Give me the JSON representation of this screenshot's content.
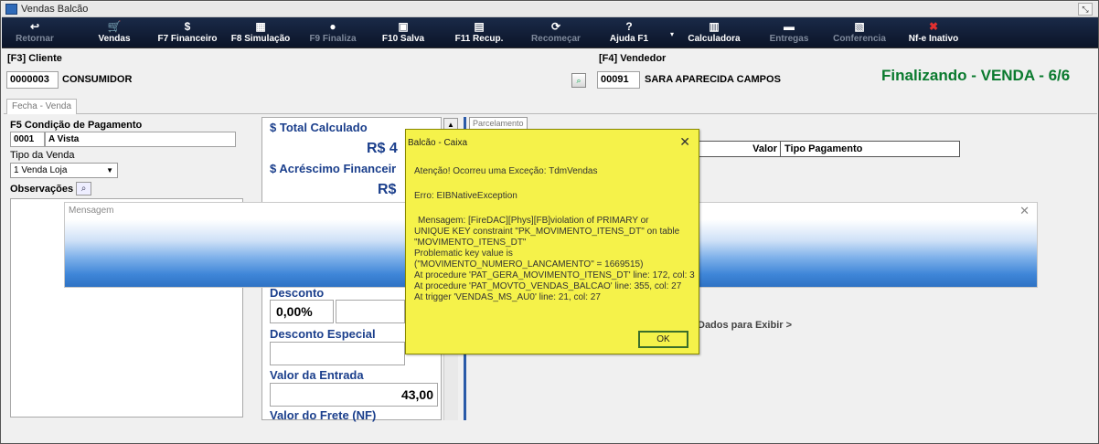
{
  "window": {
    "title": "Vendas Balcão",
    "restore_glyph": "⤡"
  },
  "toolbar": {
    "items": [
      {
        "label": "Retornar",
        "icon": "return-arrow-icon",
        "glyph": "↩",
        "enabled": false
      },
      {
        "label": "Vendas",
        "icon": "sales-icon",
        "glyph": "🛒",
        "enabled": true
      },
      {
        "label": "F7 Financeiro",
        "icon": "money-icon",
        "glyph": "$",
        "enabled": true
      },
      {
        "label": "F8 Simulação",
        "icon": "calculator-grid-icon",
        "glyph": "▦",
        "enabled": true
      },
      {
        "label": "F9 Finaliza",
        "icon": "finish-icon",
        "glyph": "●",
        "enabled": false
      },
      {
        "label": "F10 Salva",
        "icon": "save-icon",
        "glyph": "▣",
        "enabled": true
      },
      {
        "label": "F11 Recup.",
        "icon": "recover-icon",
        "glyph": "▤",
        "enabled": true
      },
      {
        "label": "Recomeçar",
        "icon": "restart-icon",
        "glyph": "⟳",
        "enabled": false
      },
      {
        "label": "Ajuda F1",
        "icon": "help-icon",
        "glyph": "?",
        "enabled": true
      },
      {
        "label": "Calculadora",
        "icon": "calculator-icon",
        "glyph": "▥",
        "enabled": true
      },
      {
        "label": "Entregas",
        "icon": "truck-icon",
        "glyph": "▬",
        "enabled": false
      },
      {
        "label": "Conferencia",
        "icon": "checklist-icon",
        "glyph": "▧",
        "enabled": false
      },
      {
        "label": "Nf-e Inativo",
        "icon": "nfe-inactive-icon",
        "glyph": "✖",
        "enabled": true
      }
    ],
    "dropdown_glyph": "▾"
  },
  "cliente": {
    "header": "[F3] Cliente",
    "codigo": "0000003",
    "nome": "CONSUMIDOR",
    "lookup_glyph": "⌕"
  },
  "vendedor": {
    "header": "[F4] Vendedor",
    "codigo": "00091",
    "nome": "SARA APARECIDA CAMPOS"
  },
  "status": "Finalizando - VENDA - 6/6",
  "tab": "Fecha - Venda",
  "pagamento": {
    "label": "F5 Condição de Pagamento",
    "codigo": "0001",
    "descricao": "A Vista",
    "tipo_label": "Tipo da Venda",
    "tipo_value": "1 Venda Loja",
    "tipo_arrow": "▼",
    "obs_label": "Observações",
    "search_glyph": "⌕"
  },
  "totais": {
    "total_label": "$ Total Calculado",
    "total_value": "R$ 4",
    "acrescimo_label": "$ Acréscimo Financeir",
    "acrescimo_value": "R$",
    "desconto_label": "Desconto",
    "desconto_value": "0,00%",
    "desconto_especial_label": "Desconto Especial",
    "entrada_label": "Valor da Entrada",
    "entrada_value": "43,00",
    "frete_label": "Valor do Frete (NF)",
    "scroll_glyph": "▲"
  },
  "parcelamento": {
    "tab": "Parcelamento",
    "columns": [
      "Valor",
      "Tipo Pagamento"
    ],
    "empty_text": "Dados para Exibir >"
  },
  "mensagem": {
    "title": "Mensagem",
    "close_glyph": "✕"
  },
  "dialog": {
    "title": "Balcão - Caixa",
    "close_glyph": "✕",
    "lines": [
      "Atenção! Ocorreu uma Exceção: TdmVendas",
      "Erro: EIBNativeException",
      "Mensagem: [FireDAC][Phys][FB]violation of PRIMARY or",
      "UNIQUE KEY constraint \"PK_MOVIMENTO_ITENS_DT\" on table",
      "\"MOVIMENTO_ITENS_DT\"",
      "Problematic key value is",
      "(\"MOVIMENTO_NUMERO_LANCAMENTO\" = 1669515)",
      "At procedure 'PAT_GERA_MOVIMENTO_ITENS_DT' line: 172, col: 3",
      "At procedure 'PAT_MOVTO_VENDAS_BALCAO' line: 355, col: 27",
      "At trigger 'VENDAS_MS_AU0' line: 21, col: 27"
    ],
    "ok_label": "OK"
  }
}
